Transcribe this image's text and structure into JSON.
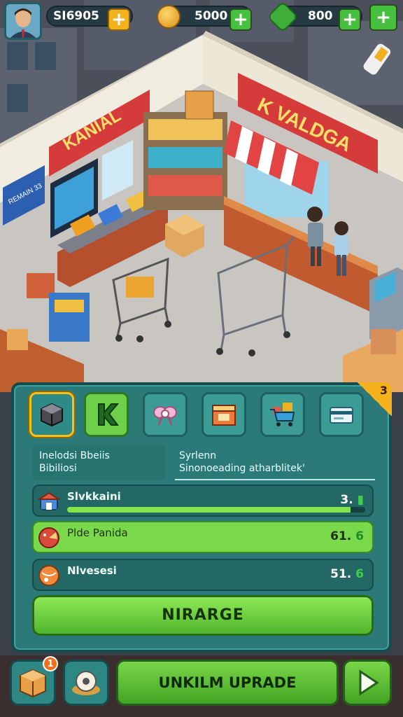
{
  "colors": {
    "panel": "#2b7a78",
    "accent_green": "#6ed04a",
    "accent_gold": "#f5b21c"
  },
  "resources": {
    "cash": {
      "icon": "cash-icon",
      "value": "SI6905"
    },
    "coins": {
      "icon": "coin-icon",
      "value": "5000"
    },
    "gems": {
      "icon": "gem-icon",
      "value": "800"
    }
  },
  "scene": {
    "left_sign": "KANIAL",
    "right_sign": "K VALDGA",
    "wall_sign": "REMAIN 33"
  },
  "panel": {
    "corner_badge": "3",
    "categories": [
      {
        "icon": "box-icon",
        "active": true
      },
      {
        "icon": "k-icon"
      },
      {
        "icon": "bow-icon"
      },
      {
        "icon": "crate-icon"
      },
      {
        "icon": "cart-icon"
      },
      {
        "icon": "card-icon"
      }
    ],
    "info_left_line1": "Inelodsi Bbeiis",
    "info_left_line2": "Bibiliosi",
    "info_right_line1": "Syrlenn",
    "info_right_line2": "Sinonoeading atharblitek'",
    "stats": [
      {
        "label": "Slvkkaini",
        "value": "3.",
        "progress": 0.95
      },
      {
        "label": "Plde Panida",
        "value": "61.",
        "value_icon": "6"
      },
      {
        "label": "Nlvesesi",
        "value": "51.",
        "value_icon": "6"
      }
    ],
    "upgrade_label": "NIRARGE"
  },
  "bottom": {
    "box_badge": "1",
    "unlock_label": "UNKILM UPRADE"
  }
}
